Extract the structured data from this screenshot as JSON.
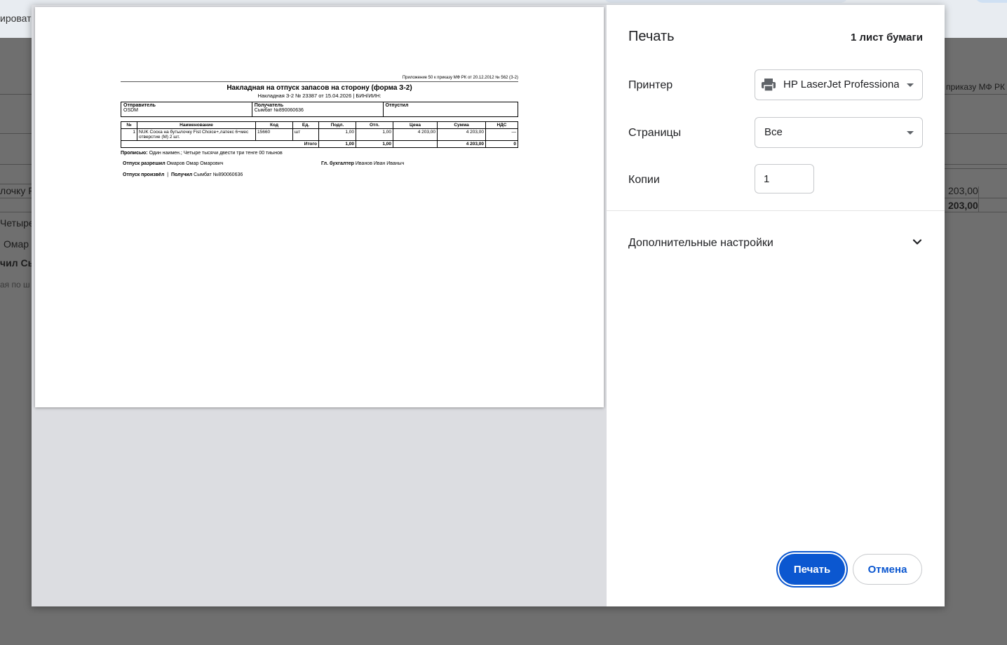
{
  "background": {
    "top_text": "ировать",
    "left_texts": [
      "лочку F",
      "Четыре",
      "Омар",
      "чил Сы",
      "ая по ш"
    ],
    "right_texts": [
      "приказу МФ РК о",
      "203,00",
      "203,00"
    ]
  },
  "dialog": {
    "title": "Печать",
    "sheets": "1 лист бумаги",
    "printer_label": "Принтер",
    "printer_value": "HP LaserJet Professional",
    "pages_label": "Страницы",
    "pages_value": "Все",
    "copies_label": "Копии",
    "copies_value": "1",
    "more_settings": "Дополнительные настройки",
    "print_button": "Печать",
    "cancel_button": "Отмена"
  },
  "document": {
    "appendix": "Приложение 50 к приказу МФ РК от 20.12.2012 № 562 (З-2)",
    "title": "Накладная на отпуск запасов на сторону (форма З-2)",
    "subtitle": "Накладная З-2 № 23387 от 15.04.2026 | БИН/ИИН:",
    "sender_label": "Отправитель",
    "sender_value": "OSDM",
    "receiver_label": "Получатель",
    "receiver_value": "Сымбат №890060636",
    "issued_label": "Отпустил",
    "issued_value": "",
    "columns": [
      "№",
      "Наименование",
      "Код",
      "Ед.",
      "Подл.",
      "Отп.",
      "Цена",
      "Сумма",
      "НДС"
    ],
    "rows": [
      [
        "1",
        "NUK Соска на бутылочку Fist Choice+,латекс 6+мес отверстие (M) 2 шт.",
        "15660",
        "шт",
        "1,00",
        "1,00",
        "4 203,00",
        "4 203,00",
        "—"
      ]
    ],
    "total_label": "Итого",
    "total": [
      "1,00",
      "1,00",
      "",
      "4 203,00",
      "0"
    ],
    "words_label": "Прописью:",
    "words_value": "Один наимен.; Четыре тысячи двести три тенге 00 тиынов",
    "allowed_label": "Отпуск разрешил",
    "allowed_value": "Омаров Омар Омарович",
    "accountant_label": "Гл. бухгалтер",
    "accountant_value": "Иванов Иван Иваныч",
    "made_label": "Отпуск произвёл",
    "received_label": "Получил",
    "received_value": "Сымбат №890060636"
  }
}
